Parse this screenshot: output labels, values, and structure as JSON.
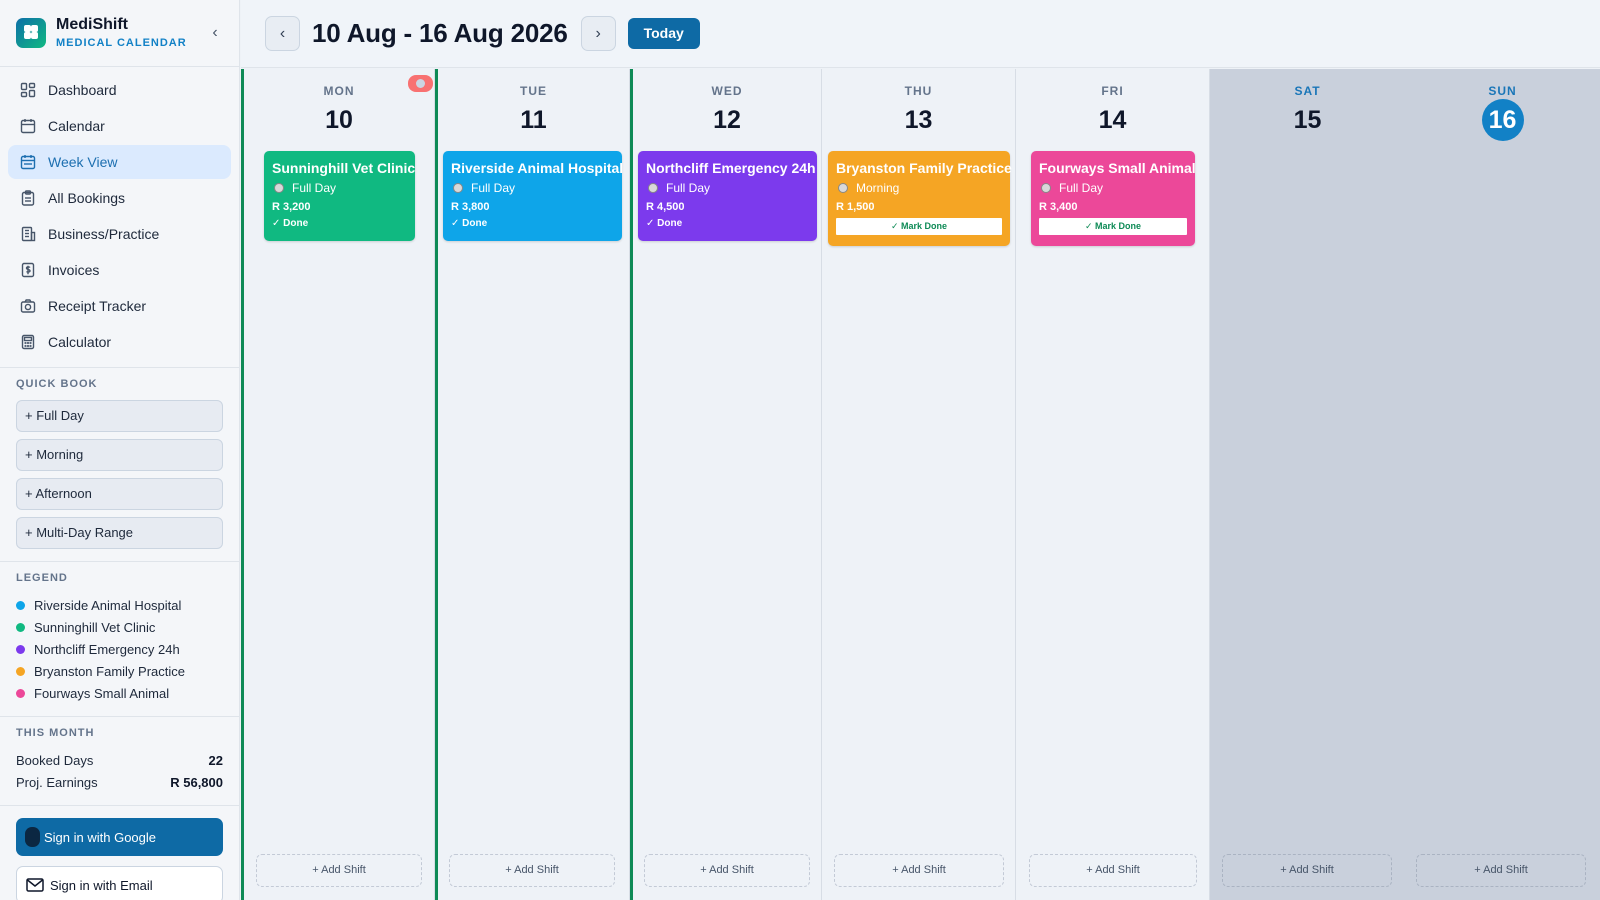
{
  "brand": {
    "name": "MediShift",
    "subtitle": "MEDICAL CALENDAR",
    "collapse_icon": "‹"
  },
  "nav": [
    {
      "label": "Dashboard",
      "icon": "dashboard-icon"
    },
    {
      "label": "Calendar",
      "icon": "calendar-icon"
    },
    {
      "label": "Week View",
      "icon": "week-view-icon",
      "active": true
    },
    {
      "label": "All Bookings",
      "icon": "clipboard-icon"
    },
    {
      "label": "Business/Practice",
      "icon": "building-icon"
    },
    {
      "label": "Invoices",
      "icon": "invoice-icon"
    },
    {
      "label": "Receipt Tracker",
      "icon": "camera-icon"
    },
    {
      "label": "Calculator",
      "icon": "calculator-icon"
    }
  ],
  "quick_book": {
    "title": "QUICK BOOK",
    "buttons": [
      "+ Full Day",
      "+ Morning",
      "+ Afternoon",
      "+ Multi-Day Range"
    ]
  },
  "legend": {
    "title": "LEGEND",
    "items": [
      {
        "label": "Riverside Animal Hospital",
        "color": "#0ea5e9"
      },
      {
        "label": "Sunninghill Vet Clinic",
        "color": "#10b981"
      },
      {
        "label": "Northcliff Emergency 24h",
        "color": "#7c3aed"
      },
      {
        "label": "Bryanston Family Practice",
        "color": "#f5a524"
      },
      {
        "label": "Fourways Small Animal",
        "color": "#ec4899"
      }
    ]
  },
  "this_month": {
    "title": "THIS MONTH",
    "booked_label": "Booked Days",
    "booked_value": "22",
    "earnings_label": "Proj. Earnings",
    "earnings_value": "R 56,800"
  },
  "auth": {
    "google_label": "Sign in with Google",
    "email_label": "Sign in with Email"
  },
  "header": {
    "prev": "‹",
    "next": "›",
    "range": "10 Aug - 16 Aug 2026",
    "today": "Today"
  },
  "days": [
    {
      "dow": "MON",
      "num": "10",
      "add": "+ Add Shift",
      "shift": {
        "name": "Sunninghill Vet Clinic",
        "time": "Full Day",
        "price": "R 3,200",
        "done": "✓ Done",
        "color": "#10b981"
      }
    },
    {
      "dow": "TUE",
      "num": "11",
      "add": "+ Add Shift",
      "shift": {
        "name": "Riverside Animal Hospital",
        "time": "Full Day",
        "price": "R 3,800",
        "done": "✓ Done",
        "color": "#0ea5e9"
      }
    },
    {
      "dow": "WED",
      "num": "12",
      "add": "+ Add Shift",
      "shift": {
        "name": "Northcliff Emergency 24h",
        "time": "Full Day",
        "price": "R 4,500",
        "done": "✓ Done",
        "color": "#7c3aed"
      }
    },
    {
      "dow": "THU",
      "num": "13",
      "add": "+ Add Shift",
      "shift": {
        "name": "Bryanston Family Practice",
        "time": "Morning",
        "price": "R 1,500",
        "mark": "✓ Mark Done",
        "color": "#f5a524"
      }
    },
    {
      "dow": "FRI",
      "num": "14",
      "add": "+ Add Shift",
      "shift": {
        "name": "Fourways Small Animal",
        "time": "Full Day",
        "price": "R 3,400",
        "mark": "✓ Mark Done",
        "color": "#ec4899"
      }
    },
    {
      "dow": "SAT",
      "num": "15",
      "add": "+ Add Shift"
    },
    {
      "dow": "SUN",
      "num": "16",
      "add": "+ Add Shift",
      "today": true
    }
  ]
}
